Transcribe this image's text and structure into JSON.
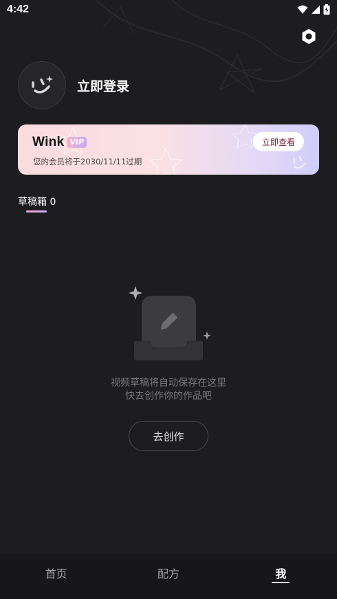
{
  "status_bar": {
    "time": "4:42",
    "icons": [
      "wifi-icon",
      "signal-icon",
      "battery-icon"
    ]
  },
  "header": {
    "settings_icon": "settings-hexagon-icon"
  },
  "profile": {
    "avatar_icon": "smiley-face-icon",
    "login_label": "立即登录"
  },
  "vip": {
    "brand": "Wink",
    "badge": "VIP",
    "expire_text": "您的会员将于2030/11/11过期",
    "button_label": "立即查看"
  },
  "tabs": [
    {
      "label": "草稿箱 0",
      "active": true
    }
  ],
  "empty_state": {
    "icon": "draft-box-pencil-icon",
    "line1": "视频草稿将自动保存在这里",
    "line2": "快去创作你的作品吧",
    "button_label": "去创作"
  },
  "bottom_nav": {
    "items": [
      {
        "label": "首页",
        "active": false
      },
      {
        "label": "配方",
        "active": false
      },
      {
        "label": "我",
        "active": true
      }
    ]
  },
  "colors": {
    "background": "#1d1d1f",
    "nav_background": "#171719",
    "vip_gradient_start": "#fbdbe0",
    "vip_gradient_end": "#cfcdfa",
    "vip_button_text": "#7a1b3f"
  }
}
